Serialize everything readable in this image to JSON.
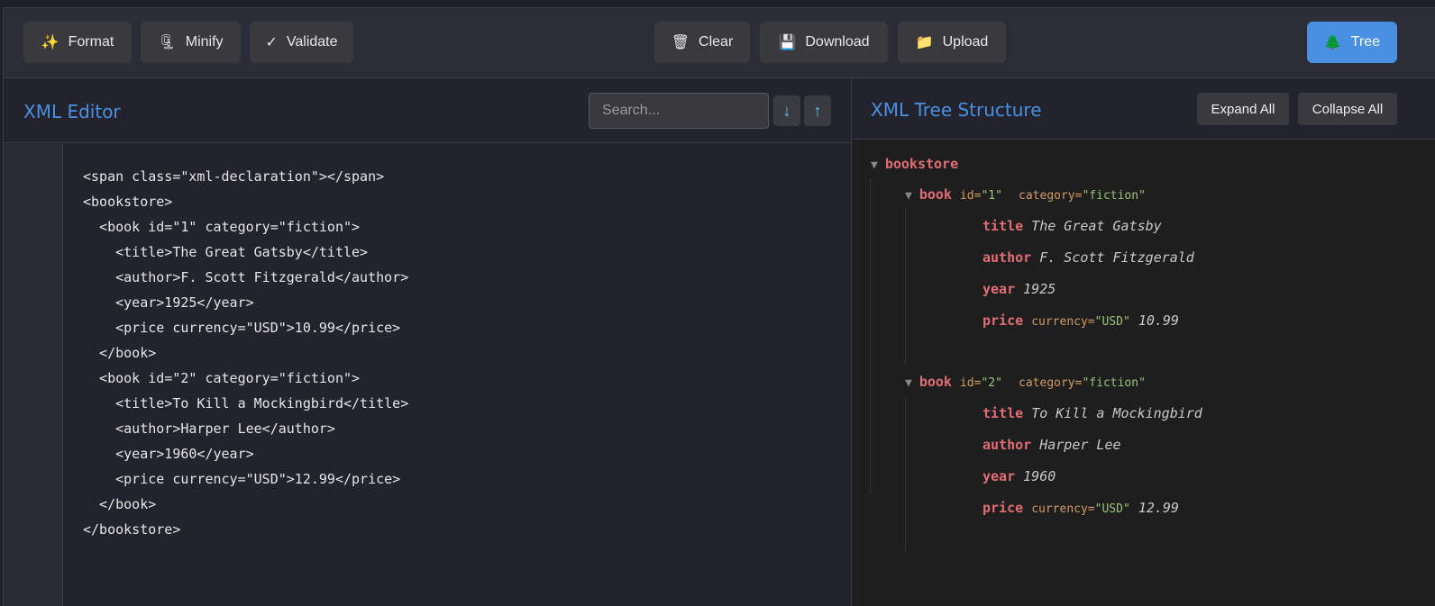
{
  "toolbar": {
    "format": "Format",
    "minify": "Minify",
    "validate": "Validate",
    "clear": "Clear",
    "download": "Download",
    "upload": "Upload",
    "tree": "Tree"
  },
  "icons": {
    "format": "✨",
    "minify": "🗜",
    "validate": "✓",
    "clear": "🗑",
    "download": "💾",
    "upload": "📁",
    "tree": "🌲"
  },
  "editor": {
    "title": "XML Editor",
    "search_placeholder": "Search...",
    "next": "↓",
    "prev": "↑",
    "lines": [
      "<span class=\"xml-declaration\"></span>",
      "<bookstore>",
      "  <book id=\"1\" category=\"fiction\">",
      "    <title>The Great Gatsby</title>",
      "    <author>F. Scott Fitzgerald</author>",
      "    <year>1925</year>",
      "    <price currency=\"USD\">10.99</price>",
      "  </book>",
      "  <book id=\"2\" category=\"fiction\">",
      "    <title>To Kill a Mockingbird</title>",
      "    <author>Harper Lee</author>",
      "    <year>1960</year>",
      "    <price currency=\"USD\">12.99</price>",
      "  </book>",
      "</bookstore>"
    ]
  },
  "tree": {
    "title": "XML Tree Structure",
    "expand": "Expand All",
    "collapse": "Collapse All",
    "root": "bookstore",
    "books": [
      {
        "tag": "book",
        "id_attr": "id=",
        "id": "\"1\"",
        "cat_attr": "category=",
        "cat": "\"fiction\"",
        "title_tag": "title",
        "title": "The Great Gatsby",
        "author_tag": "author",
        "author": "F. Scott Fitzgerald",
        "year_tag": "year",
        "year": "1925",
        "price_tag": "price",
        "cur_attr": "currency=",
        "cur": "\"USD\"",
        "price": "10.99"
      },
      {
        "tag": "book",
        "id_attr": "id=",
        "id": "\"2\"",
        "cat_attr": "category=",
        "cat": "\"fiction\"",
        "title_tag": "title",
        "title": "To Kill a Mockingbird",
        "author_tag": "author",
        "author": "Harper Lee",
        "year_tag": "year",
        "year": "1960",
        "price_tag": "price",
        "cur_attr": "currency=",
        "cur": "\"USD\"",
        "price": "12.99"
      }
    ]
  }
}
